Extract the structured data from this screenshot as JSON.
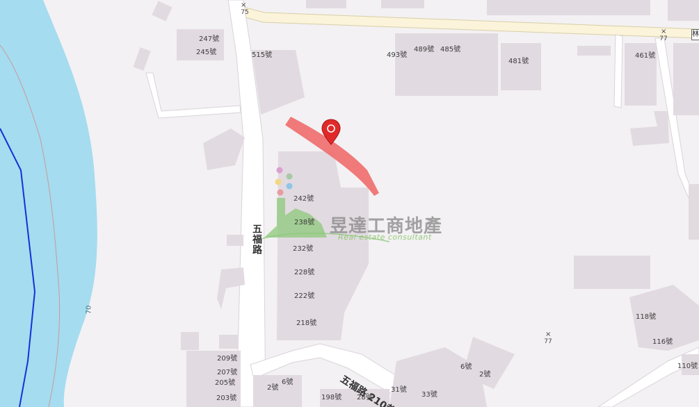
{
  "map": {
    "roads": {
      "wufu": "五福路",
      "lane210": "五福路 210巷",
      "river_route": "70"
    },
    "markers": {
      "top_left": "75",
      "top_right": "77",
      "bottom_right": "77"
    },
    "corner_tag": "林",
    "address_labels": [
      "247號",
      "245號",
      "515號",
      "493號",
      "489號",
      "485號",
      "481號",
      "461號",
      "242號",
      "238號",
      "232號",
      "228號",
      "222號",
      "218號",
      "209號",
      "207號",
      "205號",
      "203號",
      "2號",
      "6號",
      "198號",
      "28號",
      "31號",
      "33號",
      "6號",
      "2號",
      "118號",
      "116號",
      "110號"
    ],
    "watermark": {
      "title": "昱達工商地產",
      "subtitle": "Real estate consultant"
    },
    "colors": {
      "background": "#f3f1f3",
      "river": "#a5dcf0",
      "building": "#e2dae1",
      "highlight_route": "#f06b6b",
      "pin": "#e02a2a"
    },
    "icons": [
      "location-pin-icon",
      "cross-marker-icon"
    ]
  }
}
